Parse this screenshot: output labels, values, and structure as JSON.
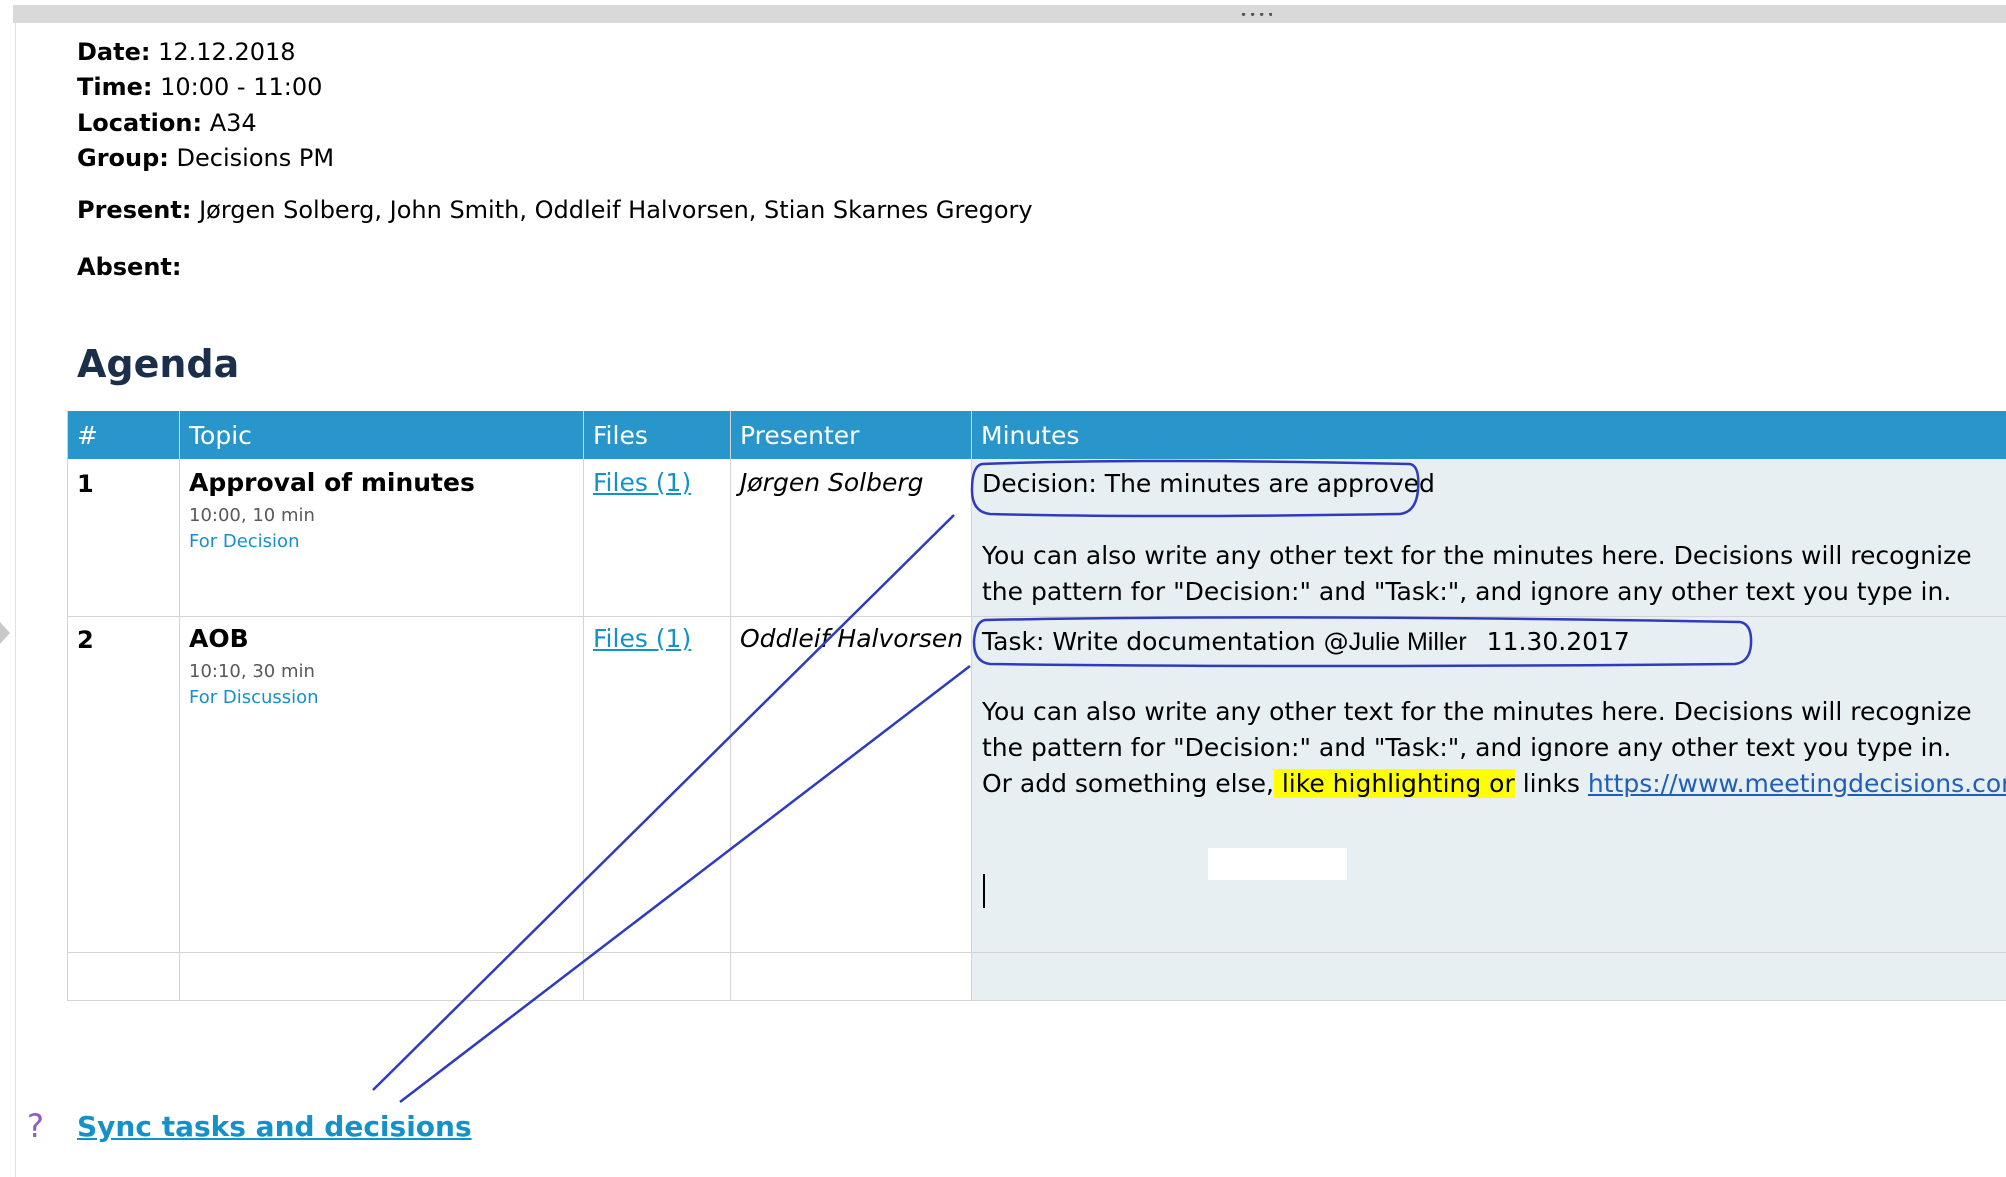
{
  "meeting": {
    "date_label": "Date:",
    "date_value": "12.12.2018",
    "time_label": "Time:",
    "time_value": "10:00 - 11:00",
    "location_label": "Location:",
    "location_value": "A34",
    "group_label": "Group:",
    "group_value": "Decisions PM",
    "present_label": "Present:",
    "present_value": "Jørgen Solberg, John Smith, Oddleif Halvorsen, Stian Skarnes Gregory",
    "absent_label": "Absent:",
    "absent_value": ""
  },
  "agenda": {
    "heading": "Agenda",
    "columns": [
      "#",
      "Topic",
      "Files",
      "Presenter",
      "Minutes"
    ],
    "items": [
      {
        "number": "1",
        "title": "Approval of minutes",
        "time": "10:00, 10 min",
        "purpose": "For Decision",
        "files": "Files (1)",
        "presenter": "Jørgen Solberg",
        "decision": "Decision: The minutes are approved",
        "note_line1": "You can also write any other text for the minutes here. Decisions will recognize",
        "note_line2": "the pattern for \"Decision:\" and \"Task:\", and ignore any other text you type in."
      },
      {
        "number": "2",
        "title": "AOB",
        "time": "10:10, 30 min",
        "purpose": "For Discussion",
        "files": "Files (1)",
        "presenter": "Oddleif Halvorsen",
        "task_prefix": "Task: Write documentation @",
        "task_assignee": "Julie Miller",
        "task_date": "11.30.2017",
        "note_line1": "You can also write any other text for the minutes here. Decisions will recognize",
        "note_line2": "the pattern for \"Decision:\" and \"Task:\", and ignore any other text you type in.",
        "note_line3_start": "Or add something else,",
        "note_line3_highlight": " like highlighting or",
        "note_line3_middle": " links ",
        "note_line3_link": "https://www.meetingdecisions.com/"
      }
    ]
  },
  "footer": {
    "help_icon": "?",
    "sync_link": "Sync tasks and decisions"
  },
  "colors": {
    "header_blue": "#2896cb",
    "link_blue": "#1591c8",
    "heading_navy": "#1b2f4a",
    "minutes_bg": "#e8eff3",
    "annotation_blue": "#2e3bbf",
    "highlight_yellow": "#ffff00"
  }
}
